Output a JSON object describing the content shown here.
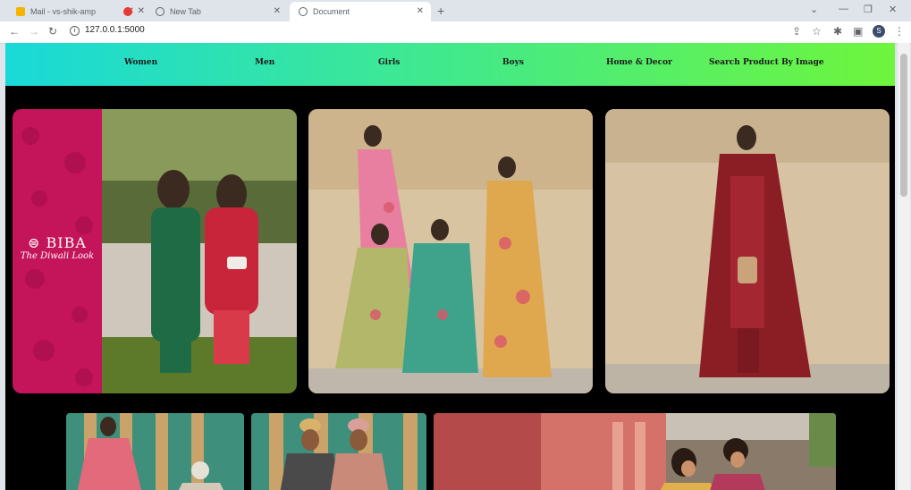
{
  "browser": {
    "tabs": [
      {
        "title": "Mail - vs-shik-amp",
        "active": false,
        "favicon_color": "#f4b400"
      },
      {
        "title": "",
        "active": false,
        "favicon_color": "#e53935"
      },
      {
        "title": "New Tab",
        "active": false,
        "favicon_color": "#5f6368"
      },
      {
        "title": "Document",
        "active": true,
        "favicon_color": "#5f6368"
      }
    ],
    "url": "127.0.0.1:5000",
    "avatar": "S"
  },
  "nav": {
    "women": "Women",
    "men": "Men",
    "girls": "Girls",
    "boys": "Boys",
    "home_decor": "Home & Decor",
    "search_by_image": "Search Product By Image"
  },
  "banner": {
    "brand": "⊜ BIBA",
    "tagline": "The Diwali Look"
  },
  "colors": {
    "nav_gradient_start": "#19d9d9",
    "nav_gradient_end": "#6ef53c",
    "page_background": "#000000",
    "biba_panel": "#c4145a"
  }
}
